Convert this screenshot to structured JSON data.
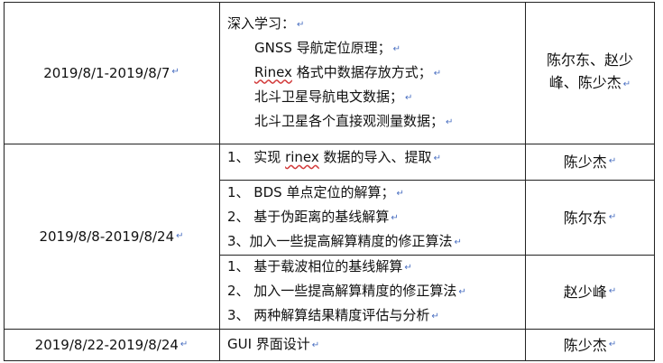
{
  "rows": [
    {
      "date": "2019/8/1-2019/8/7",
      "tasks": [
        {
          "heading": "深入学习：",
          "items": [
            "GNSS 导航定位原理；",
            "格式中数据存放方式；",
            "北斗卫星导航电文数据；",
            "北斗卫星各个直接观测量数据；"
          ],
          "rinex_word": "Rinex",
          "people_line1": "陈尔东、赵少",
          "people_line2": "峰、陈少杰"
        }
      ]
    },
    {
      "date": "2019/8/8-2019/8/24",
      "tasks": [
        {
          "items": [
            "1、 实现 ",
            "rinex",
            " 数据的导入、提取"
          ],
          "people": "陈少杰"
        },
        {
          "items": [
            "1、 BDS 单点定位的解算；",
            "2、 基于伪距离的基线解算",
            "3、加入一些提高解算精度的修正算法"
          ],
          "people": "陈尔东"
        },
        {
          "items": [
            "1、 基于载波相位的基线解算",
            "2、 加入一些提高解算精度的修正算法",
            "3、 两种解算结果精度评估与分析"
          ],
          "people": "赵少峰"
        }
      ]
    },
    {
      "date": "2019/8/22-2019/8/24",
      "tasks": [
        {
          "items": [
            "GUI 界面设计"
          ],
          "people": "陈少杰"
        }
      ]
    }
  ],
  "paragraph_mark": "↵"
}
